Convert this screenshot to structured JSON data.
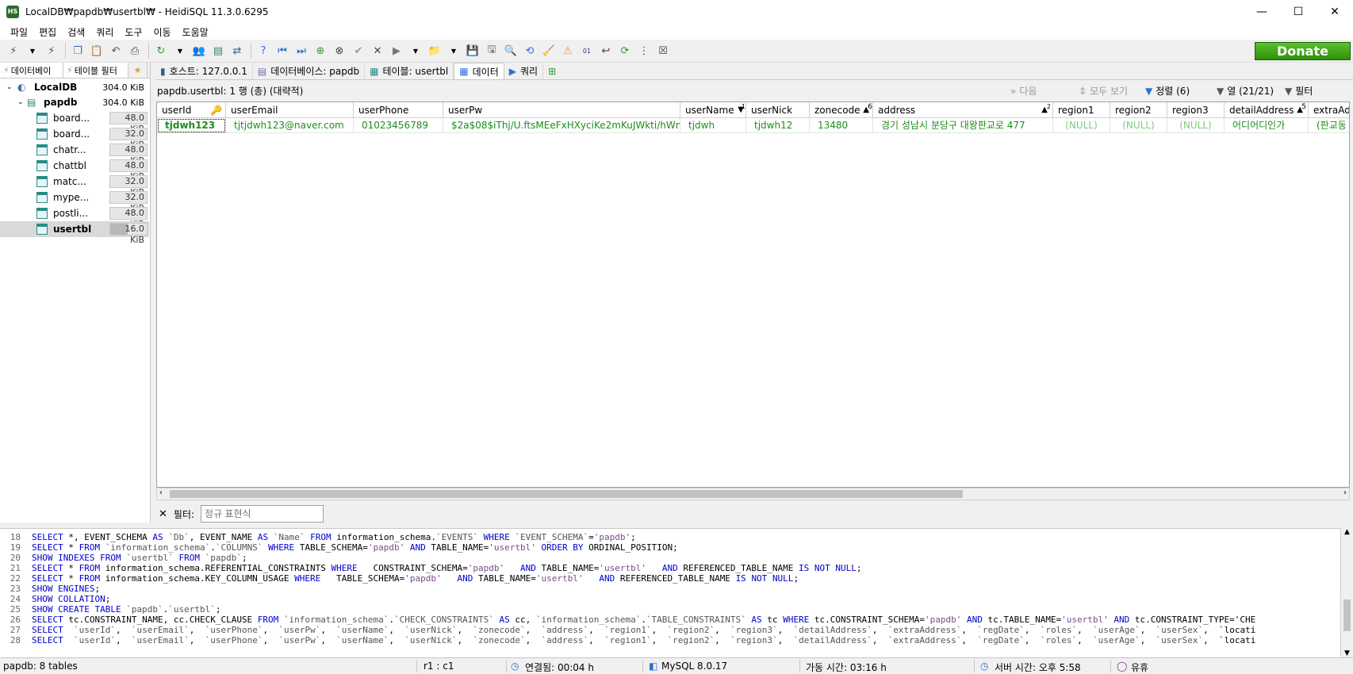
{
  "window": {
    "title": "LocalDB₩papdb₩usertbl₩ - HeidiSQL 11.3.0.6295",
    "app_icon_text": "HS",
    "minimize": "—",
    "maximize": "☐",
    "close": "✕"
  },
  "menu": [
    "파일",
    "편집",
    "검색",
    "쿼리",
    "도구",
    "이동",
    "도움말"
  ],
  "toolbar": {
    "donate_label": "Donate"
  },
  "left": {
    "tabs": [
      "데이터베이",
      "테이블 필터"
    ],
    "tree": [
      {
        "label": "LocalDB",
        "size": "304.0 KiB"
      },
      {
        "label": "papdb",
        "size": "304.0 KiB"
      },
      {
        "label": "board...",
        "size": "48.0 KiB"
      },
      {
        "label": "board...",
        "size": "32.0 KiB"
      },
      {
        "label": "chatr...",
        "size": "48.0 KiB"
      },
      {
        "label": "chattbl",
        "size": "48.0 KiB"
      },
      {
        "label": "matc...",
        "size": "32.0 KiB"
      },
      {
        "label": "mype...",
        "size": "32.0 KiB"
      },
      {
        "label": "postli...",
        "size": "48.0 KiB"
      },
      {
        "label": "usertbl",
        "size": "16.0 KiB"
      }
    ]
  },
  "tabs": [
    {
      "label": "호스트: 127.0.0.1"
    },
    {
      "label": "데이터베이스: papdb"
    },
    {
      "label": "테이블: usertbl"
    },
    {
      "label": "데이터"
    },
    {
      "label": "쿼리"
    }
  ],
  "grid": {
    "info": "papdb.usertbl: 1 행 (총) (대략적)",
    "next": "다음",
    "show_all": "모두 보기",
    "sort": "정렬 (6)",
    "columns_label": "열 (21/21)",
    "filter_label": "필터",
    "columns": [
      "userId",
      "userEmail",
      "userPhone",
      "userPw",
      "userName",
      "userNick",
      "zonecode",
      "address",
      "region1",
      "region2",
      "region3",
      "detailAddress",
      "extraAd"
    ],
    "sort_badges": {
      "zonecode": "6",
      "userName": "1",
      "address": "2",
      "detailAddress": "5"
    },
    "rows": [
      [
        "tjdwh123",
        "tjtjdwh123@naver.com",
        "01023456789",
        "$2a$08$iThj/U.ftsMEeFxHXyciKe2mKuJWkti/hWmr...",
        "tjdwh",
        "tjdwh12",
        "13480",
        "경기 성남시 분당구 대왕판교로 477",
        "(NULL)",
        "(NULL)",
        "(NULL)",
        "어디어디인가",
        "(판교동"
      ]
    ]
  },
  "filter": {
    "label": "필터:",
    "placeholder": "정규 표현식"
  },
  "log": [
    {
      "n": "18",
      "text": "SELECT *, EVENT_SCHEMA AS `Db`, EVENT_NAME AS `Name` FROM information_schema.`EVENTS` WHERE `EVENT_SCHEMA`='papdb';"
    },
    {
      "n": "19",
      "text": "SELECT * FROM `information_schema`.`COLUMNS` WHERE TABLE_SCHEMA='papdb' AND TABLE_NAME='usertbl' ORDER BY ORDINAL_POSITION;"
    },
    {
      "n": "20",
      "text": "SHOW INDEXES FROM `usertbl` FROM `papdb`;"
    },
    {
      "n": "21",
      "text": "SELECT * FROM information_schema.REFERENTIAL_CONSTRAINTS WHERE   CONSTRAINT_SCHEMA='papdb'   AND TABLE_NAME='usertbl'   AND REFERENCED_TABLE_NAME IS NOT NULL;"
    },
    {
      "n": "22",
      "text": "SELECT * FROM information_schema.KEY_COLUMN_USAGE WHERE   TABLE_SCHEMA='papdb'   AND TABLE_NAME='usertbl'   AND REFERENCED_TABLE_NAME IS NOT NULL;"
    },
    {
      "n": "23",
      "text": "SHOW ENGINES;"
    },
    {
      "n": "24",
      "text": "SHOW COLLATION;"
    },
    {
      "n": "25",
      "text": "SHOW CREATE TABLE `papdb`.`usertbl`;"
    },
    {
      "n": "26",
      "text": "SELECT tc.CONSTRAINT_NAME, cc.CHECK_CLAUSE FROM `information_schema`.`CHECK_CONSTRAINTS` AS cc, `information_schema`.`TABLE_CONSTRAINTS` AS tc WHERE tc.CONSTRAINT_SCHEMA='papdb' AND tc.TABLE_NAME='usertbl' AND tc.CONSTRAINT_TYPE='CHE"
    },
    {
      "n": "27",
      "text": "SELECT  `userId`,  `userEmail`,  `userPhone`,  `userPw`,  `userName`,  `userNick`,  `zonecode`,  `address`,  `region1`,  `region2`,  `region3`,  `detailAddress`,  `extraAddress`,  `regDate`,  `roles`,  `userAge`,  `userSex`,  `locati"
    },
    {
      "n": "28",
      "text": "SELECT  `userId`,  `userEmail`,  `userPhone`,  `userPw`,  `userName`,  `userNick`,  `zonecode`,  `address`,  `region1`,  `region2`,  `region3`,  `detailAddress`,  `extraAddress`,  `regDate`,  `roles`,  `userAge`,  `userSex`,  `locati"
    }
  ],
  "status": {
    "tables": "papdb: 8 tables",
    "pos": "r1 : c1",
    "connected": "연결됨: 00:04 h",
    "server": "MySQL 8.0.17",
    "uptime": "가동 시간: 03:16 h",
    "server_time": "서버 시간: 오후 5:58",
    "idle": "유휴"
  }
}
